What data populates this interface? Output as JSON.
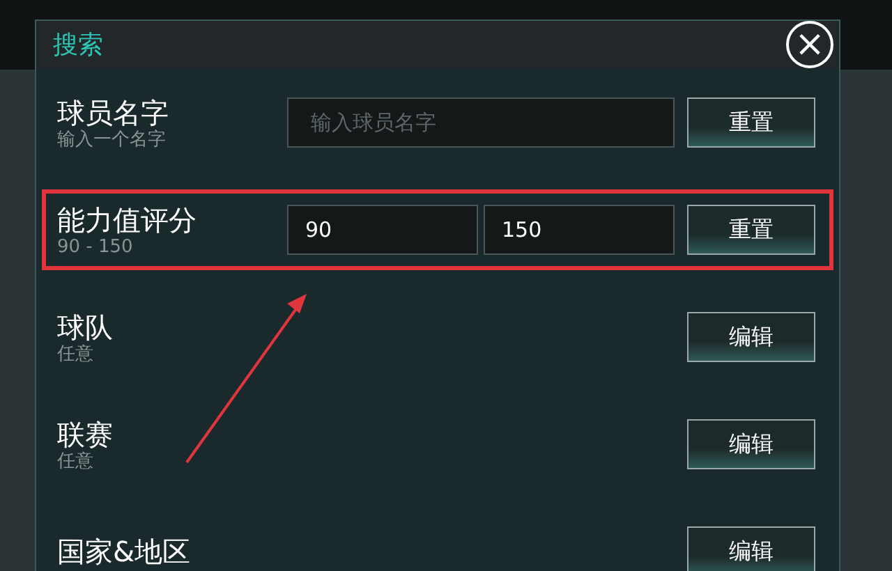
{
  "dialog": {
    "title": "搜索",
    "close": "×"
  },
  "filters": [
    {
      "kind": "text",
      "label": "球员名字",
      "hint": "输入一个名字",
      "placeholder": "输入球员名字",
      "button": "重置",
      "highlighted": false
    },
    {
      "kind": "range",
      "label": "能力值评分",
      "hint": "90 - 150",
      "min": "90",
      "max": "150",
      "button": "重置",
      "highlighted": true
    },
    {
      "kind": "picker",
      "label": "球队",
      "hint": "任意",
      "button": "编辑",
      "highlighted": false
    },
    {
      "kind": "picker",
      "label": "联赛",
      "hint": "任意",
      "button": "编辑",
      "highlighted": false
    },
    {
      "kind": "picker",
      "label": "国家&地区",
      "button": "编辑",
      "highlighted": false
    }
  ]
}
